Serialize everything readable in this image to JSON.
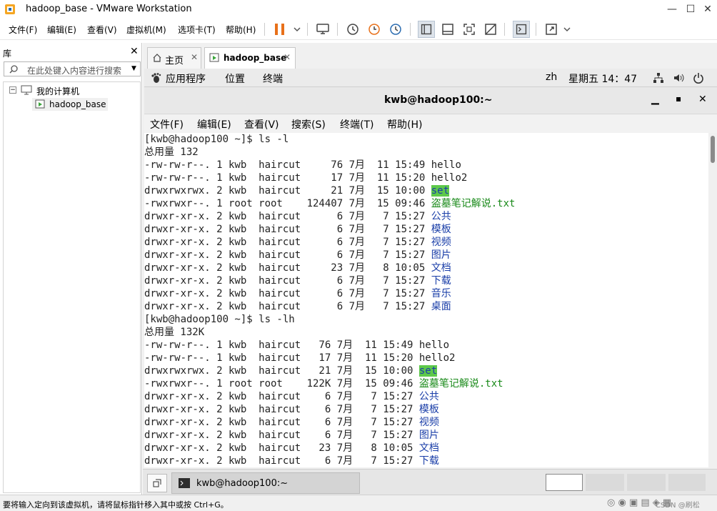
{
  "window": {
    "title": "hadoop_base - VMware Workstation"
  },
  "menu": [
    "文件(F)",
    "编辑(E)",
    "查看(V)",
    "虚拟机(M)",
    "选项卡(T)",
    "帮助(H)"
  ],
  "library": {
    "header": "库",
    "search_placeholder": "在此处键入内容进行搜索",
    "tree_root": "我的计算机",
    "tree_child": "hadoop_base"
  },
  "tabs": {
    "home": "主页",
    "vm": "hadoop_base"
  },
  "gnome": {
    "apps": "应用程序",
    "places": "位置",
    "terminal": "终端",
    "lang": "zh",
    "clock": "星期五 14：47"
  },
  "terminal": {
    "title": "kwb@hadoop100:~",
    "menu": [
      "文件(F)",
      "编辑(E)",
      "查看(V)",
      "搜索(S)",
      "终端(T)",
      "帮助(H)"
    ],
    "lines": [
      {
        "t": "[kwb@hadoop100 ~]$ ls -l"
      },
      {
        "t": "总用量 132"
      },
      {
        "t": "-rw-rw-r--. 1 kwb  haircut     76 7月  11 15:49 ",
        "n": "hello"
      },
      {
        "t": "-rw-rw-r--. 1 kwb  haircut     17 7月  11 15:20 ",
        "n": "hello2"
      },
      {
        "t": "drwxrwxrwx. 2 kwb  haircut     21 7月  15 10:00 ",
        "n": "set",
        "c": "hl"
      },
      {
        "t": "-rwxrwxr--. 1 root root    124407 7月  15 09:46 ",
        "n": "盗墓笔记解说.txt",
        "c": "grn"
      },
      {
        "t": "drwxr-xr-x. 2 kwb  haircut      6 7月   7 15:27 ",
        "n": "公共",
        "c": "dir"
      },
      {
        "t": "drwxr-xr-x. 2 kwb  haircut      6 7月   7 15:27 ",
        "n": "模板",
        "c": "dir"
      },
      {
        "t": "drwxr-xr-x. 2 kwb  haircut      6 7月   7 15:27 ",
        "n": "视频",
        "c": "dir"
      },
      {
        "t": "drwxr-xr-x. 2 kwb  haircut      6 7月   7 15:27 ",
        "n": "图片",
        "c": "dir"
      },
      {
        "t": "drwxr-xr-x. 2 kwb  haircut     23 7月   8 10:05 ",
        "n": "文档",
        "c": "dir"
      },
      {
        "t": "drwxr-xr-x. 2 kwb  haircut      6 7月   7 15:27 ",
        "n": "下载",
        "c": "dir"
      },
      {
        "t": "drwxr-xr-x. 2 kwb  haircut      6 7月   7 15:27 ",
        "n": "音乐",
        "c": "dir"
      },
      {
        "t": "drwxr-xr-x. 2 kwb  haircut      6 7月   7 15:27 ",
        "n": "桌面",
        "c": "dir"
      },
      {
        "t": "[kwb@hadoop100 ~]$ ls -lh"
      },
      {
        "t": "总用量 132K"
      },
      {
        "t": "-rw-rw-r--. 1 kwb  haircut   76 7月  11 15:49 ",
        "n": "hello"
      },
      {
        "t": "-rw-rw-r--. 1 kwb  haircut   17 7月  11 15:20 ",
        "n": "hello2"
      },
      {
        "t": "drwxrwxrwx. 2 kwb  haircut   21 7月  15 10:00 ",
        "n": "set",
        "c": "hl"
      },
      {
        "t": "-rwxrwxr--. 1 root root    122K 7月  15 09:46 ",
        "n": "盗墓笔记解说.txt",
        "c": "grn"
      },
      {
        "t": "drwxr-xr-x. 2 kwb  haircut    6 7月   7 15:27 ",
        "n": "公共",
        "c": "dir"
      },
      {
        "t": "drwxr-xr-x. 2 kwb  haircut    6 7月   7 15:27 ",
        "n": "模板",
        "c": "dir"
      },
      {
        "t": "drwxr-xr-x. 2 kwb  haircut    6 7月   7 15:27 ",
        "n": "视频",
        "c": "dir"
      },
      {
        "t": "drwxr-xr-x. 2 kwb  haircut    6 7月   7 15:27 ",
        "n": "图片",
        "c": "dir"
      },
      {
        "t": "drwxr-xr-x. 2 kwb  haircut   23 7月   8 10:05 ",
        "n": "文档",
        "c": "dir"
      },
      {
        "t": "drwxr-xr-x. 2 kwb  haircut    6 7月   7 15:27 ",
        "n": "下载",
        "c": "dir"
      }
    ]
  },
  "taskbar": {
    "task": "kwb@hadoop100:~"
  },
  "status": {
    "text": "要将输入定向到该虚拟机，请将鼠标指针移入其中或按 Ctrl+G。",
    "watermark": "CSDN @刷松"
  },
  "colors": {
    "accent_orange": "#e8701a",
    "dir_blue": "#1a3ea8",
    "exec_green": "#1a8a1a",
    "set_bg": "#5ec94a"
  }
}
